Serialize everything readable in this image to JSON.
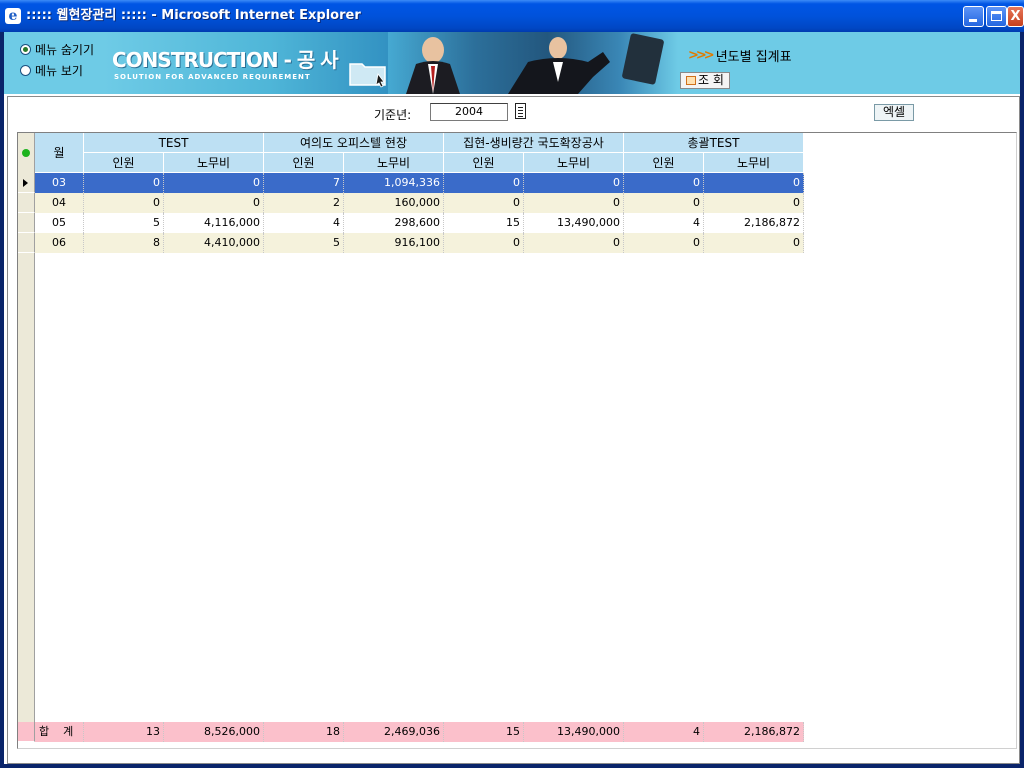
{
  "window": {
    "title": "::::: 웹현장관리 ::::: - Microsoft Internet Explorer",
    "close_glyph": "X"
  },
  "banner": {
    "menu_options": [
      "메뉴 숨기기",
      "메뉴 보기"
    ],
    "menu_selected": 0,
    "brand": "CONSTRUCTION - 공 사",
    "tagline": "SOLUTION FOR ADVANCED REQUIREMENT",
    "yearly_label": "년도별 집계표",
    "query_button": "조 회"
  },
  "filters": {
    "year_label": "기준년:",
    "year_value": "2004",
    "excel_button": "엑셀"
  },
  "grid": {
    "month_header": "월",
    "groups": [
      "TEST",
      "여의도 오피스텔 현장",
      "집현-생비량간 국도확장공사",
      "총괄TEST"
    ],
    "subheaders": [
      "인원",
      "노무비"
    ],
    "selected_row": 0,
    "rows": [
      {
        "month": "03",
        "values": [
          "0",
          "0",
          "7",
          "1,094,336",
          "0",
          "0",
          "0",
          "0"
        ]
      },
      {
        "month": "04",
        "values": [
          "0",
          "0",
          "2",
          "160,000",
          "0",
          "0",
          "0",
          "0"
        ]
      },
      {
        "month": "05",
        "values": [
          "5",
          "4,116,000",
          "4",
          "298,600",
          "15",
          "13,490,000",
          "4",
          "2,186,872"
        ]
      },
      {
        "month": "06",
        "values": [
          "8",
          "4,410,000",
          "5",
          "916,100",
          "0",
          "0",
          "0",
          "0"
        ]
      }
    ],
    "total": {
      "label": "합계",
      "values": [
        "13",
        "8,526,000",
        "18",
        "2,469,036",
        "15",
        "13,490,000",
        "4",
        "2,186,872"
      ]
    }
  },
  "colors": {
    "header": "#bde0f3",
    "row_even": "#ffffff",
    "row_odd": "#f5f2dc",
    "selected": "#3a6bc9",
    "total": "#fbc0cb",
    "banner": "#6ecbe6"
  }
}
